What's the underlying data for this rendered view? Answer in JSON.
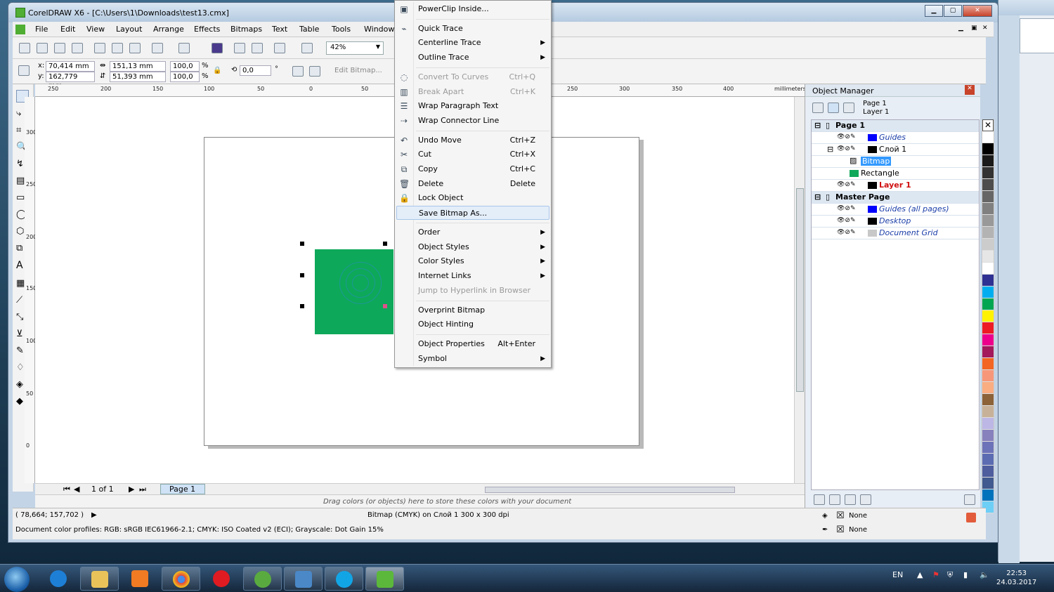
{
  "app": {
    "title": "CorelDRAW X6 - [C:\\Users\\1\\Downloads\\test13.cmx]"
  },
  "menubar": [
    "File",
    "Edit",
    "View",
    "Layout",
    "Arrange",
    "Effects",
    "Bitmaps",
    "Text",
    "Table",
    "Tools",
    "Window"
  ],
  "toolbar": {
    "zoom": "42%"
  },
  "props": {
    "x": "70,414 mm",
    "y": "162,779 mm",
    "w": "151,13 mm",
    "h": "51,393 mm",
    "sx": "100,0",
    "sy": "100,0",
    "pct": "%",
    "rot": "0,0",
    "deg": "°",
    "edit_bitmap": "Edit Bitmap..."
  },
  "ruler": {
    "unit": "millimeters",
    "h_ticks": [
      "250",
      "200",
      "150",
      "100",
      "50",
      "0",
      "50",
      "250",
      "300",
      "350",
      "400"
    ],
    "v_ticks": [
      "300",
      "250",
      "200",
      "150",
      "100",
      "50",
      "0"
    ]
  },
  "pagenav": {
    "counter": "1 of 1",
    "tab": "Page 1"
  },
  "palette_hint": "Drag colors (or objects) here to store these colors with your document",
  "status": {
    "coords": "( 78,664; 157,702 )",
    "info": "Bitmap (CMYK) on Слой 1 300 x 300 dpi",
    "profiles": "Document color profiles: RGB: sRGB IEC61966-2.1; CMYK: ISO Coated v2 (ECI); Grayscale: Dot Gain 15%",
    "fill": "None",
    "outline": "None"
  },
  "context_menu": [
    {
      "label": "PowerClip Inside...",
      "shortcut": "",
      "submenu": false,
      "disabled": false,
      "icon": "powerclip-icon"
    },
    {
      "label": "Quick Trace",
      "shortcut": "",
      "submenu": false,
      "disabled": false,
      "icon": "trace-icon"
    },
    {
      "label": "Centerline Trace",
      "shortcut": "",
      "submenu": true,
      "disabled": false,
      "icon": ""
    },
    {
      "label": "Outline Trace",
      "shortcut": "",
      "submenu": true,
      "disabled": false,
      "icon": ""
    },
    {
      "label": "Convert To Curves",
      "shortcut": "Ctrl+Q",
      "submenu": false,
      "disabled": true,
      "icon": "curves-icon"
    },
    {
      "label": "Break Apart",
      "shortcut": "Ctrl+K",
      "submenu": false,
      "disabled": true,
      "icon": "break-apart-icon"
    },
    {
      "label": "Wrap Paragraph Text",
      "shortcut": "",
      "submenu": false,
      "disabled": false,
      "icon": "wrap-text-icon"
    },
    {
      "label": "Wrap Connector Line",
      "shortcut": "",
      "submenu": false,
      "disabled": false,
      "icon": "connector-icon"
    },
    {
      "label": "Undo Move",
      "shortcut": "Ctrl+Z",
      "submenu": false,
      "disabled": false,
      "icon": "undo-icon"
    },
    {
      "label": "Cut",
      "shortcut": "Ctrl+X",
      "submenu": false,
      "disabled": false,
      "icon": "scissors-icon"
    },
    {
      "label": "Copy",
      "shortcut": "Ctrl+C",
      "submenu": false,
      "disabled": false,
      "icon": "copy-icon"
    },
    {
      "label": "Delete",
      "shortcut": "Delete",
      "submenu": false,
      "disabled": false,
      "icon": "trash-icon"
    },
    {
      "label": "Lock Object",
      "shortcut": "",
      "submenu": false,
      "disabled": false,
      "icon": "lock-icon"
    },
    {
      "label": "Save Bitmap As...",
      "shortcut": "",
      "submenu": false,
      "disabled": false,
      "icon": ""
    },
    {
      "label": "Order",
      "shortcut": "",
      "submenu": true,
      "disabled": false,
      "icon": ""
    },
    {
      "label": "Object Styles",
      "shortcut": "",
      "submenu": true,
      "disabled": false,
      "icon": ""
    },
    {
      "label": "Color Styles",
      "shortcut": "",
      "submenu": true,
      "disabled": false,
      "icon": ""
    },
    {
      "label": "Internet Links",
      "shortcut": "",
      "submenu": true,
      "disabled": false,
      "icon": ""
    },
    {
      "label": "Jump to Hyperlink in Browser",
      "shortcut": "",
      "submenu": false,
      "disabled": true,
      "icon": ""
    },
    {
      "label": "Overprint Bitmap",
      "shortcut": "",
      "submenu": false,
      "disabled": false,
      "icon": ""
    },
    {
      "label": "Object Hinting",
      "shortcut": "",
      "submenu": false,
      "disabled": false,
      "icon": ""
    },
    {
      "label": "Object Properties",
      "shortcut": "Alt+Enter",
      "submenu": false,
      "disabled": false,
      "icon": ""
    },
    {
      "label": "Symbol",
      "shortcut": "",
      "submenu": true,
      "disabled": false,
      "icon": ""
    }
  ],
  "docker": {
    "title": "Object Manager",
    "header_page": "Page 1",
    "header_layer": "Layer 1",
    "rows": [
      {
        "label": "Page 1",
        "kind": "page",
        "color": "",
        "italic": false,
        "textcolor": "#000"
      },
      {
        "label": "Guides",
        "kind": "layer",
        "color": "#0000ff",
        "italic": true,
        "textcolor": "#1a3da8"
      },
      {
        "label": "Слой 1",
        "kind": "layer",
        "color": "#000000",
        "italic": false,
        "textcolor": "#000"
      },
      {
        "label": "Bitmap",
        "kind": "object-selected",
        "color": "",
        "italic": false,
        "textcolor": "#fff"
      },
      {
        "label": "Rectangle",
        "kind": "object",
        "color": "#0ea85a",
        "italic": false,
        "textcolor": "#000"
      },
      {
        "label": "Layer 1",
        "kind": "layer",
        "color": "#000000",
        "italic": false,
        "textcolor": "#d01010"
      },
      {
        "label": "Master Page",
        "kind": "page",
        "color": "",
        "italic": false,
        "textcolor": "#000"
      },
      {
        "label": "Guides (all pages)",
        "kind": "layer",
        "color": "#0000ff",
        "italic": true,
        "textcolor": "#1a3da8"
      },
      {
        "label": "Desktop",
        "kind": "layer",
        "color": "#000000",
        "italic": true,
        "textcolor": "#1a3da8"
      },
      {
        "label": "Document Grid",
        "kind": "layer",
        "color": "#c8c8c8",
        "italic": true,
        "textcolor": "#1a3da8"
      }
    ]
  },
  "palette_colors": [
    "#ffffff",
    "#000000",
    "#1a1a1a",
    "#333333",
    "#4d4d4d",
    "#666666",
    "#808080",
    "#999999",
    "#b3b3b3",
    "#cccccc",
    "#e6e6e6",
    "#ffffff",
    "#2e3192",
    "#00aeef",
    "#00a651",
    "#fff200",
    "#ed1c24",
    "#ec008c",
    "#a3195b",
    "#f26522",
    "#f7977a",
    "#f9ad81",
    "#8c6239",
    "#c7b299",
    "#bdb7e5",
    "#8781bd",
    "#6d73b8",
    "#5b6cb2",
    "#4d5d9e",
    "#415a8f",
    "#0072bc",
    "#6dcff6"
  ],
  "taskbar": {
    "lang": "EN",
    "time": "22:53",
    "date": "24.03.2017"
  }
}
